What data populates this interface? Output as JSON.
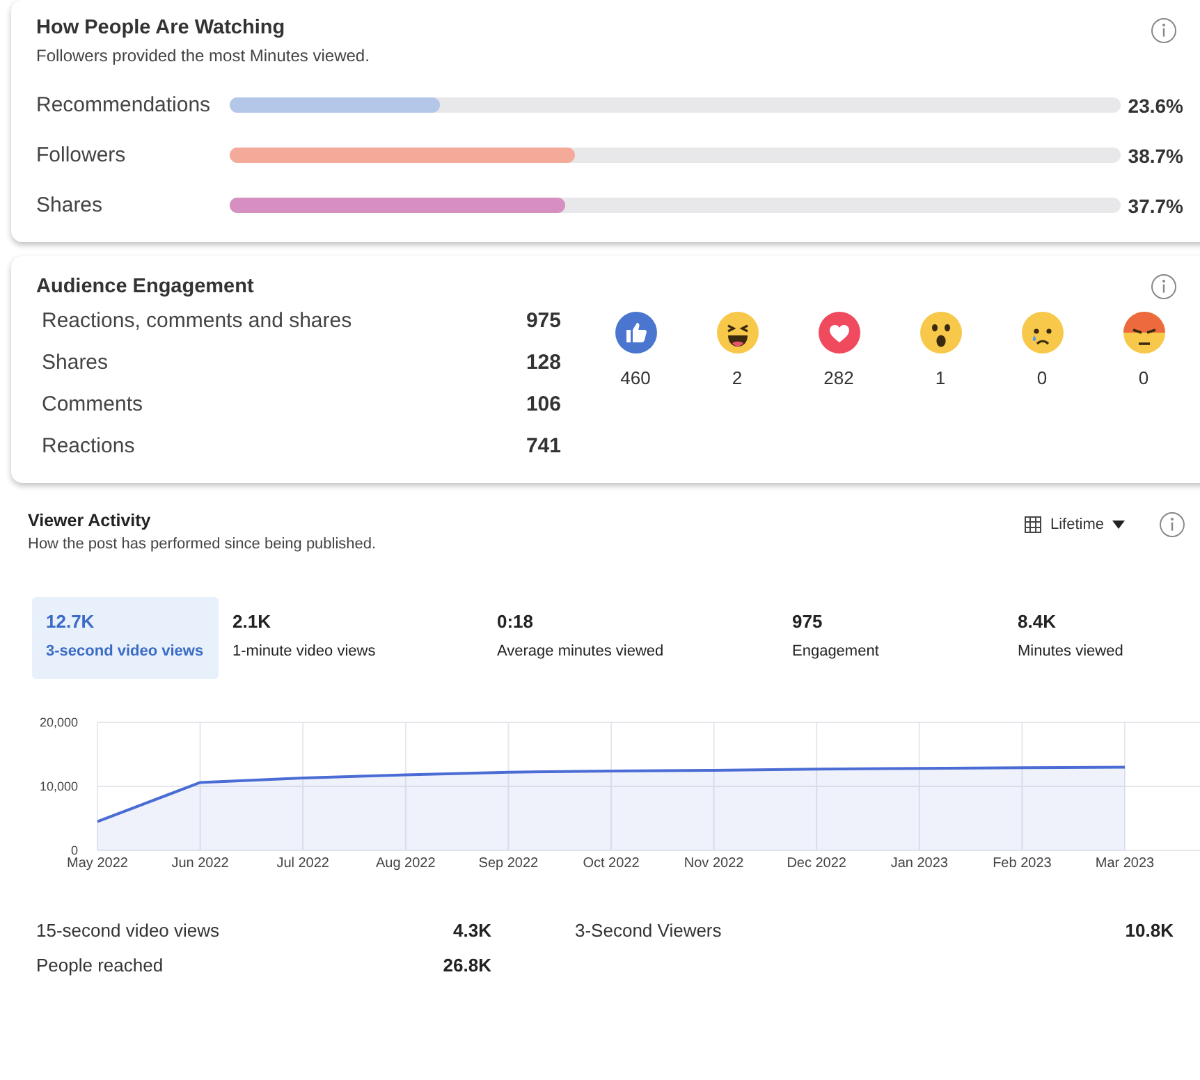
{
  "watching": {
    "title": "How People Are Watching",
    "subtitle": "Followers provided the most Minutes viewed.",
    "sources": [
      {
        "label": "Recommendations",
        "level": 0.236,
        "value": "23.6%",
        "color": "#b4c7e9"
      },
      {
        "label": "Followers",
        "level": 0.387,
        "value": "38.7%",
        "color": "#f5aa99"
      },
      {
        "label": "Shares",
        "level": 0.377,
        "value": "37.7%",
        "color": "#d68fc1"
      }
    ]
  },
  "engagement": {
    "title": "Audience Engagement",
    "stats": [
      {
        "label": "Reactions, comments and shares",
        "value": "975"
      },
      {
        "label": "Shares",
        "value": "128"
      },
      {
        "label": "Comments",
        "value": "106"
      },
      {
        "label": "Reactions",
        "value": "741"
      }
    ],
    "reactions": [
      {
        "kind": "like",
        "count": "460"
      },
      {
        "kind": "haha",
        "count": "2"
      },
      {
        "kind": "love",
        "count": "282"
      },
      {
        "kind": "wow",
        "count": "1"
      },
      {
        "kind": "sad",
        "count": "0"
      },
      {
        "kind": "angry",
        "count": "0"
      }
    ]
  },
  "activity": {
    "title": "Viewer Activity",
    "subtitle": "How the post has performed since being published.",
    "period": "Lifetime",
    "tabs": [
      {
        "value": "12.7K",
        "label": "3-second video views",
        "selected": true
      },
      {
        "value": "2.1K",
        "label": "1-minute video views",
        "selected": false
      },
      {
        "value": "0:18",
        "label": "Average minutes viewed",
        "selected": false
      },
      {
        "value": "975",
        "label": "Engagement",
        "selected": false
      },
      {
        "value": "8.4K",
        "label": "Minutes viewed",
        "selected": false
      }
    ],
    "chart_data": {
      "type": "area",
      "categories": [
        "May 2022",
        "Jun 2022",
        "Jul 2022",
        "Aug 2022",
        "Sep 2022",
        "Oct 2022",
        "Nov 2022",
        "Dec 2022",
        "Jan 2023",
        "Feb 2023",
        "Mar 2023"
      ],
      "grid": true,
      "series": [
        {
          "color": "#4a6cd4",
          "values": [
            4500,
            10600,
            11300,
            11800,
            12200,
            12400,
            12500,
            12700,
            12800,
            12900,
            13000
          ]
        }
      ],
      "ylim": [
        0,
        20000
      ],
      "yticks": [
        {
          "value": 0,
          "label": "0"
        },
        {
          "value": 10000,
          "label": "10,000"
        },
        {
          "value": 20000,
          "label": "20,000"
        }
      ]
    },
    "stats": [
      {
        "label": "15-second video views",
        "value": "4.3K"
      },
      {
        "label": "3-Second Viewers",
        "value": "10.8K"
      },
      {
        "label": "People reached",
        "value": "26.8K"
      }
    ]
  }
}
